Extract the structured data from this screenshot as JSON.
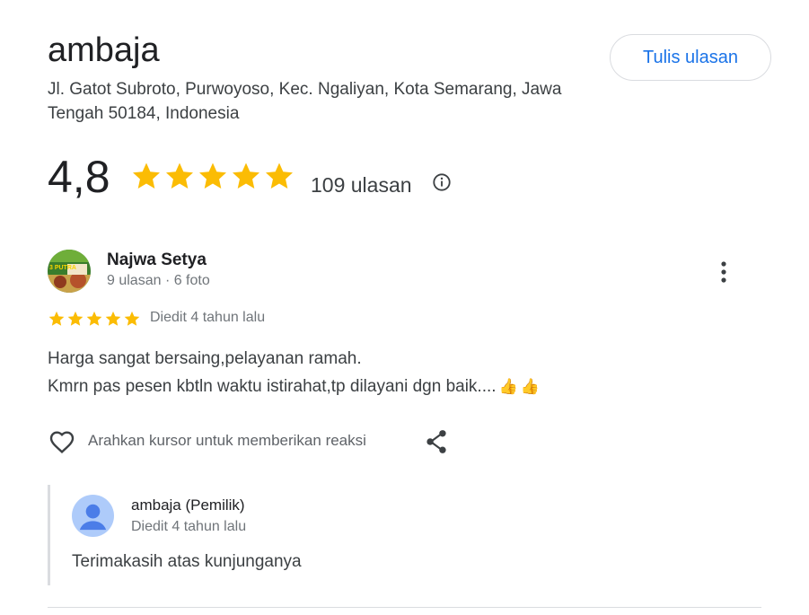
{
  "header": {
    "title": "ambaja",
    "address": "Jl. Gatot Subroto, Purwoyoso, Kec. Ngaliyan, Kota Semarang, Jawa Tengah 50184, Indonesia",
    "write_review_label": "Tulis ulasan"
  },
  "rating": {
    "value": "4,8",
    "stars": 5,
    "count_label": "109 ulasan",
    "star_color": "#fbbc04"
  },
  "review": {
    "reviewer_name": "Najwa Setya",
    "reviewer_meta": "9 ulasan · 6 foto",
    "avatar_text": "3 PUTRA",
    "stars": 5,
    "date_label": "Diedit 4 tahun lalu",
    "text_line1": "Harga sangat bersaing,pelayanan ramah.",
    "text_line2": "Kmrn pas pesen kbtln waktu istirahat,tp dilayani dgn baik....",
    "emoji": "👍",
    "react_label": "Arahkan kursor untuk memberikan reaksi"
  },
  "owner_reply": {
    "name": "ambaja (Pemilik)",
    "date_label": "Diedit 4 tahun lalu",
    "text": "Terimakasih atas kunjunganya"
  },
  "colors": {
    "accent": "#1a73e8",
    "star": "#fbbc04"
  }
}
